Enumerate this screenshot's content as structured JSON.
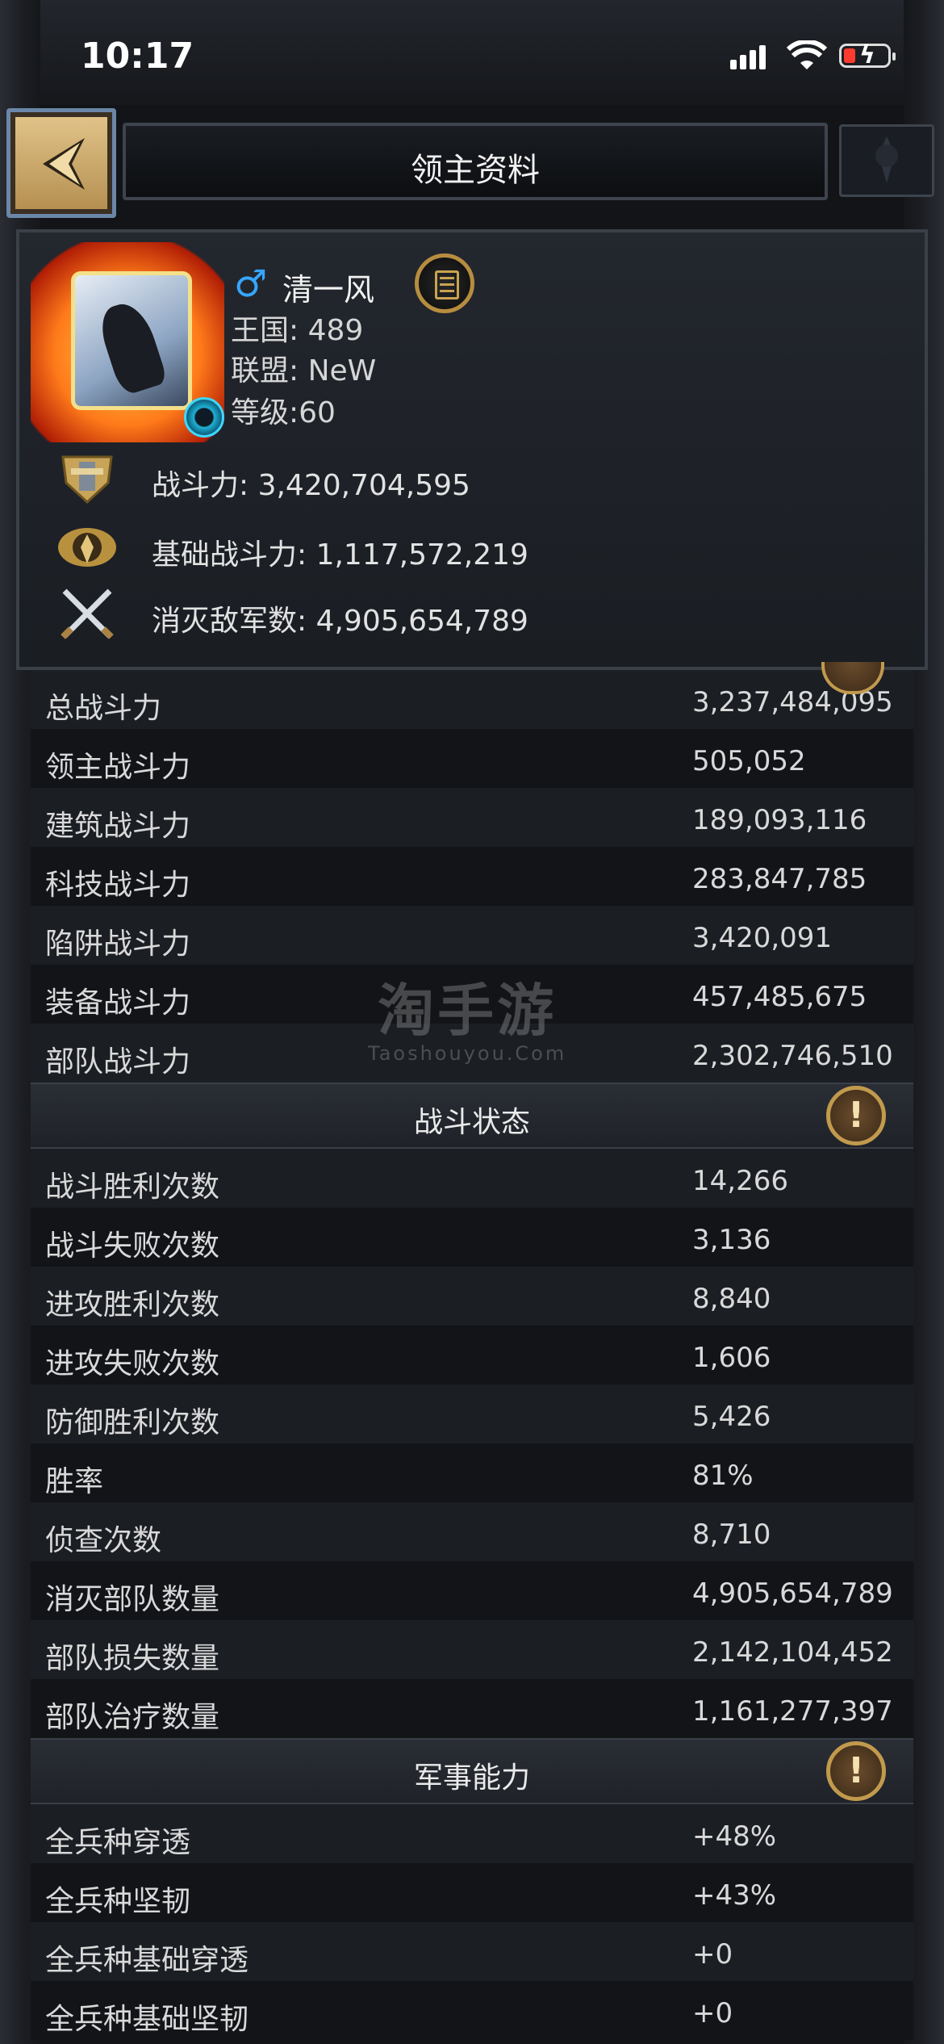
{
  "status": {
    "time": "10:17"
  },
  "header": {
    "title": "领主资料"
  },
  "profile": {
    "name": "清一风",
    "gender_symbol": "♂",
    "kingdom_label": "王国:",
    "kingdom": "489",
    "alliance_label": "联盟:",
    "alliance": "NeW",
    "level": "等级:60",
    "stats": [
      {
        "icon": "shield-crest-icon",
        "text": "战斗力: 3,420,704,595"
      },
      {
        "icon": "winged-helmet-icon",
        "text": "基础战斗力: 1,117,572,219"
      },
      {
        "icon": "crossed-swords-icon",
        "text": "消灭敌军数: 4,905,654,789"
      }
    ]
  },
  "power_rows": [
    {
      "k": "总战斗力",
      "v": "3,237,484,095"
    },
    {
      "k": "领主战斗力",
      "v": "505,052"
    },
    {
      "k": "建筑战斗力",
      "v": "189,093,116"
    },
    {
      "k": "科技战斗力",
      "v": "283,847,785"
    },
    {
      "k": "陷阱战斗力",
      "v": "3,420,091"
    },
    {
      "k": "装备战斗力",
      "v": "457,485,675"
    },
    {
      "k": "部队战斗力",
      "v": "2,302,746,510"
    }
  ],
  "battle": {
    "title": "战斗状态",
    "rows": [
      {
        "k": "战斗胜利次数",
        "v": "14,266"
      },
      {
        "k": "战斗失败次数",
        "v": "3,136"
      },
      {
        "k": "进攻胜利次数",
        "v": "8,840"
      },
      {
        "k": "进攻失败次数",
        "v": "1,606"
      },
      {
        "k": "防御胜利次数",
        "v": "5,426"
      },
      {
        "k": "胜率",
        "v": "81%"
      },
      {
        "k": "侦查次数",
        "v": "8,710"
      },
      {
        "k": "消灭部队数量",
        "v": "4,905,654,789"
      },
      {
        "k": "部队损失数量",
        "v": "2,142,104,452"
      },
      {
        "k": "部队治疗数量",
        "v": "1,161,277,397"
      }
    ]
  },
  "military": {
    "title": "军事能力",
    "rows": [
      {
        "k": "全兵种穿透",
        "v": "+48%"
      },
      {
        "k": "全兵种坚韧",
        "v": "+43%"
      },
      {
        "k": "全兵种基础穿透",
        "v": "+0"
      },
      {
        "k": "全兵种基础坚韧",
        "v": "+0"
      }
    ]
  },
  "watermark": {
    "big": "淘手游",
    "small": "Taoshouyou.Com"
  }
}
